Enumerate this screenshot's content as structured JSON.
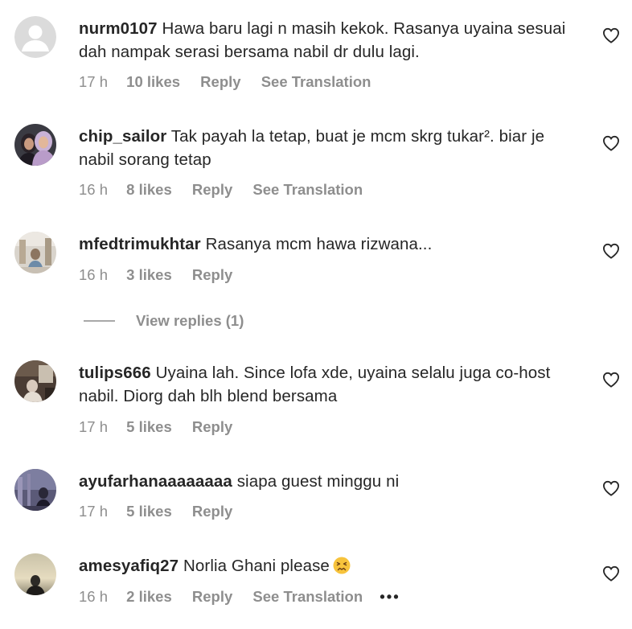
{
  "comments": [
    {
      "username": "nurm0107",
      "text": "Hawa baru lagi n masih kekok. Rasanya uyaina sesuai dah nampak serasi bersama nabil dr dulu lagi.",
      "time": "17 h",
      "likes": "10 likes",
      "reply": "Reply",
      "translate": "See Translation"
    },
    {
      "username": "chip_sailor",
      "text": "Tak payah la tetap, buat je mcm skrg tukar². biar je nabil sorang tetap",
      "time": "16 h",
      "likes": "8 likes",
      "reply": "Reply",
      "translate": "See Translation"
    },
    {
      "username": "mfedtrimukhtar",
      "text": "Rasanya mcm hawa rizwana...",
      "time": "16 h",
      "likes": "3 likes",
      "reply": "Reply"
    },
    {
      "username": "tulips666",
      "text": "Uyaina lah. Since lofa xde, uyaina selalu juga co-host nabil. Diorg dah blh blend bersama",
      "time": "17 h",
      "likes": "5 likes",
      "reply": "Reply"
    },
    {
      "username": "ayufarhanaaaaaaaa",
      "text": "siapa guest minggu ni",
      "time": "17 h",
      "likes": "5 likes",
      "reply": "Reply"
    },
    {
      "username": "amesyafiq27",
      "text": "Norlia Ghani please",
      "time": "16 h",
      "likes": "2 likes",
      "reply": "Reply",
      "translate": "See Translation",
      "more": "•••"
    }
  ],
  "view_replies": {
    "label": "View replies (1)"
  },
  "icons": {
    "like": "heart-outline-icon",
    "emoji": "persevering-face-emoji"
  },
  "colors": {
    "text": "#262626",
    "secondary": "#8e8e8e",
    "background": "#ffffff"
  }
}
